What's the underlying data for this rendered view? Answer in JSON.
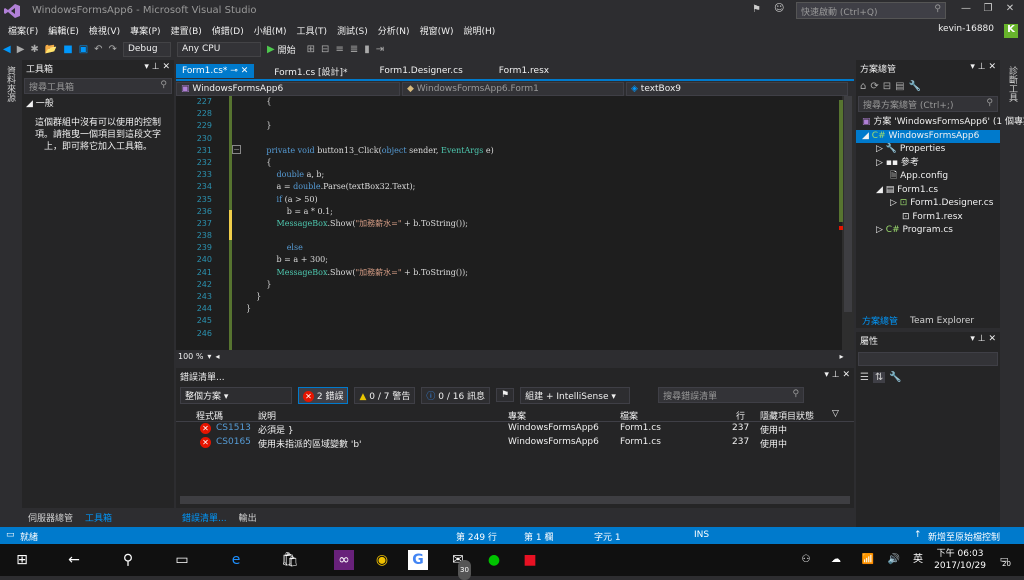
{
  "window": {
    "title": "WindowsFormsApp6 - Microsoft Visual Studio",
    "quick_launch": "快速啟動 (Ctrl+Q)"
  },
  "menu": [
    "檔案(F)",
    "編輯(E)",
    "檢視(V)",
    "專案(P)",
    "建置(B)",
    "偵錯(D)",
    "小組(M)",
    "工具(T)",
    "測試(S)",
    "分析(N)",
    "視窗(W)",
    "說明(H)"
  ],
  "user": {
    "name": "kevin-16880",
    "initial": "K"
  },
  "toolbar": {
    "config": "Debug",
    "platform": "Any CPU",
    "start": "開始"
  },
  "left_strip": {
    "items": [
      "資料來源",
      "伺服器總管"
    ]
  },
  "toolbox": {
    "title": "工具箱",
    "search_placeholder": "搜尋工具箱",
    "group": "一般",
    "empty_text": "這個群組中沒有可以使用的控制項。請拖曳一個項目到這段文字上，即可將它加入工具箱。"
  },
  "left_bottom_tabs": [
    "伺服器總管",
    "工具箱"
  ],
  "tabs": [
    {
      "label": "Form1.cs*"
    },
    {
      "label": "Form1.cs [設計]*"
    },
    {
      "label": "Form1.Designer.cs"
    },
    {
      "label": "Form1.resx"
    }
  ],
  "navbar": {
    "project": "WindowsFormsApp6",
    "class": "WindowsFormsApp6.Form1",
    "member": "textBox9"
  },
  "editor": {
    "line_numbers": [
      "227",
      "228",
      "229",
      "230",
      "231",
      "232",
      "233",
      "234",
      "235",
      "236",
      "237",
      "238",
      "239",
      "240",
      "241",
      "242",
      "243",
      "244",
      "245",
      "246"
    ],
    "lines": [
      {
        "parts": [
          {
            "t": "        {",
            "c": ""
          }
        ]
      },
      {
        "parts": [
          {
            "t": "",
            "c": ""
          }
        ]
      },
      {
        "parts": [
          {
            "t": "        }",
            "c": ""
          }
        ]
      },
      {
        "parts": [
          {
            "t": "",
            "c": ""
          }
        ]
      },
      {
        "parts": [
          {
            "t": "        private void ",
            "c": "kw"
          },
          {
            "t": "button13_Click(",
            "c": ""
          },
          {
            "t": "object",
            "c": "kw"
          },
          {
            "t": " sender, ",
            "c": ""
          },
          {
            "t": "EventArgs",
            "c": "ty"
          },
          {
            "t": " e)",
            "c": ""
          }
        ]
      },
      {
        "parts": [
          {
            "t": "        {",
            "c": ""
          }
        ]
      },
      {
        "parts": [
          {
            "t": "            double",
            "c": "kw"
          },
          {
            "t": " a, b;",
            "c": ""
          }
        ]
      },
      {
        "parts": [
          {
            "t": "            a = ",
            "c": ""
          },
          {
            "t": "double",
            "c": "kw"
          },
          {
            "t": ".Parse(textBox32.Text);",
            "c": ""
          }
        ]
      },
      {
        "parts": [
          {
            "t": "            if",
            "c": "kw"
          },
          {
            "t": " (a > 50)",
            "c": ""
          }
        ]
      },
      {
        "parts": [
          {
            "t": "                b = a * 0.1;",
            "c": ""
          }
        ]
      },
      {
        "parts": [
          {
            "t": "            MessageBox",
            "c": "ty"
          },
          {
            "t": ".Show(",
            "c": ""
          },
          {
            "t": "\"加務薪水=\"",
            "c": "st"
          },
          {
            "t": " + b.ToString());",
            "c": ""
          }
        ]
      },
      {
        "parts": [
          {
            "t": "",
            "c": ""
          }
        ]
      },
      {
        "parts": [
          {
            "t": "                else",
            "c": "kw"
          }
        ]
      },
      {
        "parts": [
          {
            "t": "            b = a + 300;",
            "c": ""
          }
        ]
      },
      {
        "parts": [
          {
            "t": "            MessageBox",
            "c": "ty"
          },
          {
            "t": ".Show(",
            "c": ""
          },
          {
            "t": "\"加務薪水=\"",
            "c": "st"
          },
          {
            "t": " + b.ToString());",
            "c": ""
          }
        ]
      },
      {
        "parts": [
          {
            "t": "        }",
            "c": ""
          }
        ]
      },
      {
        "parts": [
          {
            "t": "    }",
            "c": ""
          }
        ]
      },
      {
        "parts": [
          {
            "t": "}",
            "c": ""
          }
        ]
      },
      {
        "parts": [
          {
            "t": "",
            "c": ""
          }
        ]
      },
      {
        "parts": [
          {
            "t": "",
            "c": ""
          }
        ]
      }
    ],
    "zoom": "100 %"
  },
  "errors": {
    "title": "錯誤清單...",
    "scope": "整個方案",
    "errors_btn": "2 錯誤",
    "warnings_btn": "0 / 7 警告",
    "messages_btn": "0 / 16 訊息",
    "filter": "組建 + IntelliSense",
    "search_placeholder": "搜尋錯誤清單",
    "headers": [
      "程式碼",
      "說明",
      "專案",
      "檔案",
      "行",
      "隱藏項目狀態"
    ],
    "rows": [
      [
        "CS1513",
        "必須是 }",
        "WindowsFormsApp6",
        "Form1.cs",
        "237",
        "使用中"
      ],
      [
        "CS0165",
        "使用未指派的區域變數 'b'",
        "WindowsFormsApp6",
        "Form1.cs",
        "237",
        "使用中"
      ]
    ],
    "bottom_tabs": [
      "錯誤清單...",
      "輸出"
    ]
  },
  "solution": {
    "title": "方案總管",
    "search_placeholder": "搜尋方案總管 (Ctrl+;)",
    "items": [
      "方案 'WindowsFormsApp6' (1 個專案)",
      "WindowsFormsApp6",
      "Properties",
      "參考",
      "App.config",
      "Form1.cs",
      "Form1.Designer.cs",
      "Form1.resx",
      "Program.cs"
    ],
    "bottom_tabs": [
      "方案總管",
      "Team Explorer"
    ]
  },
  "properties": {
    "title": "屬性"
  },
  "right_strip": {
    "items": [
      "診斷工具"
    ]
  },
  "status": {
    "ready": "就緒",
    "line": "第 249 行",
    "col": "第 1 欄",
    "char": "字元 1",
    "ins": "INS",
    "source_control": "新增至原始檔控制"
  },
  "taskbar": {
    "time": "下午 06:03",
    "date": "2017/10/29",
    "ime": "英",
    "badge": "20",
    "mail_badge": "30"
  },
  "colors": {
    "accent": "#007acc",
    "error": "#e51400",
    "editor_bg": "#1e1e1e"
  }
}
